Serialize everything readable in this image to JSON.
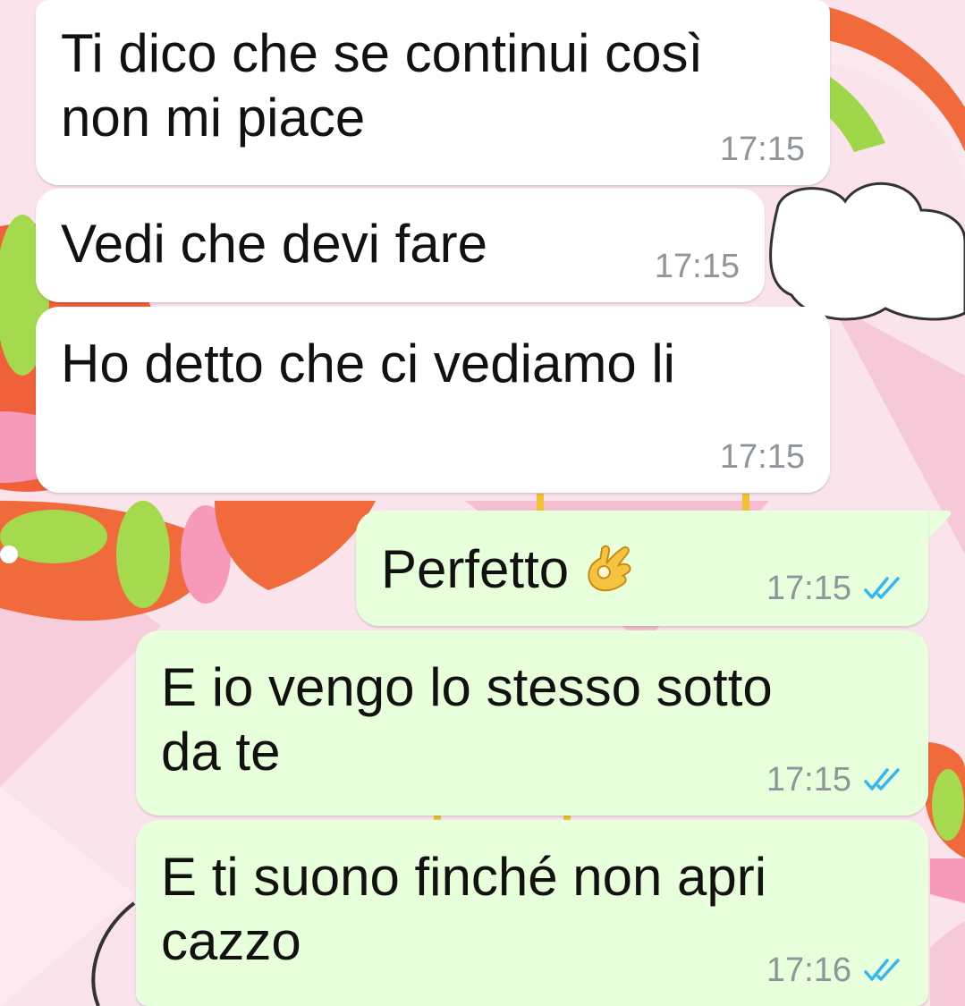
{
  "messages": [
    {
      "direction": "in",
      "text": "Ti dico che se continui così\nnon mi piace",
      "time": "17:15"
    },
    {
      "direction": "in",
      "text": "Vedi che devi fare",
      "time": "17:15"
    },
    {
      "direction": "in",
      "text": "Ho detto che ci vediamo li",
      "time": "17:15"
    },
    {
      "direction": "out",
      "text": "Perfetto",
      "emoji": "ok-hand-emoji",
      "time": "17:15",
      "status": "read-double-check-icon"
    },
    {
      "direction": "out",
      "text": "E io vengo lo stesso sotto\nda te",
      "time": "17:15",
      "status": "read-double-check-icon"
    },
    {
      "direction": "out",
      "text": "E ti suono finché non apri\ncazzo",
      "time": "17:16",
      "status": "read-double-check-icon"
    }
  ],
  "colors": {
    "incoming_bubble": "#ffffff",
    "outgoing_bubble": "#e7ffdb",
    "timestamp": "#8e969b",
    "read_ticks": "#34b7f1",
    "wallpaper_base": "#fbe3ec"
  }
}
